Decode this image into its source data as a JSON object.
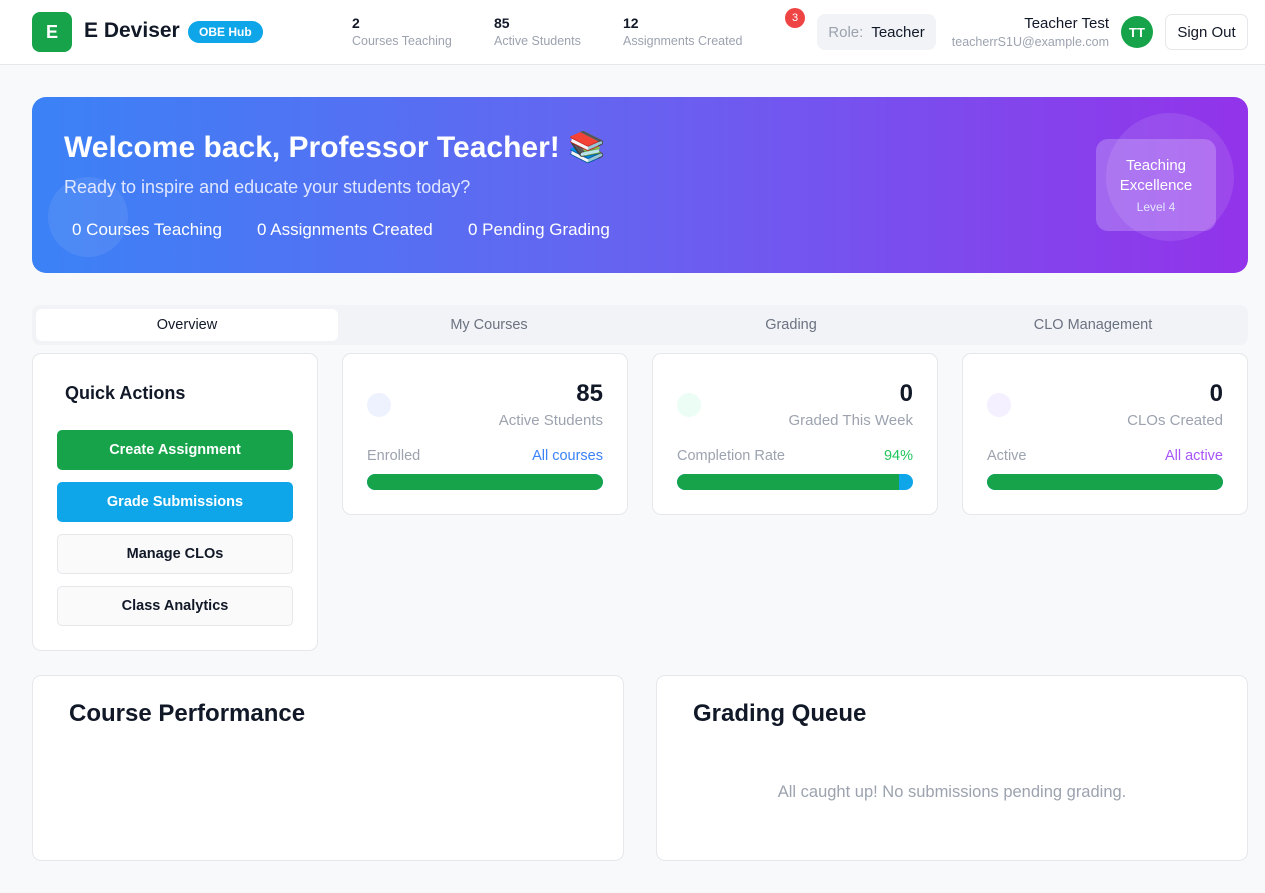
{
  "header": {
    "logo_letter": "E",
    "app_name": "E Deviser",
    "badge": "OBE Hub",
    "stats": [
      {
        "value": "2",
        "label": "Courses Teaching"
      },
      {
        "value": "85",
        "label": "Active Students"
      },
      {
        "value": "12",
        "label": "Assignments Created"
      }
    ],
    "notification_count": "3",
    "role_label": "Role:",
    "role_value": "Teacher",
    "user_name": "Teacher Test",
    "user_email": "teacherrS1U@example.com",
    "avatar_initials": "TT",
    "signout_label": "Sign Out"
  },
  "banner": {
    "title": "Welcome back, Professor Teacher! 📚",
    "subtitle": "Ready to inspire and educate your students today?",
    "stats": [
      "0 Courses Teaching",
      "0 Assignments Created",
      "0 Pending Grading"
    ],
    "excellence_title": "Teaching Excellence",
    "excellence_level": "Level 4"
  },
  "tabs": [
    {
      "label": "Overview",
      "active": true
    },
    {
      "label": "My Courses",
      "active": false
    },
    {
      "label": "Grading",
      "active": false
    },
    {
      "label": "CLO Management",
      "active": false
    }
  ],
  "quick_actions": {
    "title": "Quick Actions",
    "buttons": [
      "Create Assignment",
      "Grade Submissions",
      "Manage CLOs",
      "Class Analytics"
    ]
  },
  "stat_cards": [
    {
      "value": "85",
      "label": "Active Students",
      "foot_label": "Enrolled",
      "foot_value": "All courses",
      "foot_color": "#3b82f6",
      "dot_color": "#eef2ff",
      "progress": 1.0
    },
    {
      "value": "0",
      "label": "Graded This Week",
      "foot_label": "Completion Rate",
      "foot_value": "94%",
      "foot_color": "#22c55e",
      "dot_color": "#ecfdf5",
      "progress": 0.94
    },
    {
      "value": "0",
      "label": "CLOs Created",
      "foot_label": "Active",
      "foot_value": "All active",
      "foot_color": "#a855f7",
      "dot_color": "#f5f0ff",
      "progress": 1.0
    }
  ],
  "course_performance": {
    "title": "Course Performance"
  },
  "grading_queue": {
    "title": "Grading Queue",
    "empty_message": "All caught up! No submissions pending grading."
  },
  "colors": {
    "brand_green": "#16a34a",
    "brand_blue": "#0ea5e9",
    "notification_red": "#ef4444"
  }
}
